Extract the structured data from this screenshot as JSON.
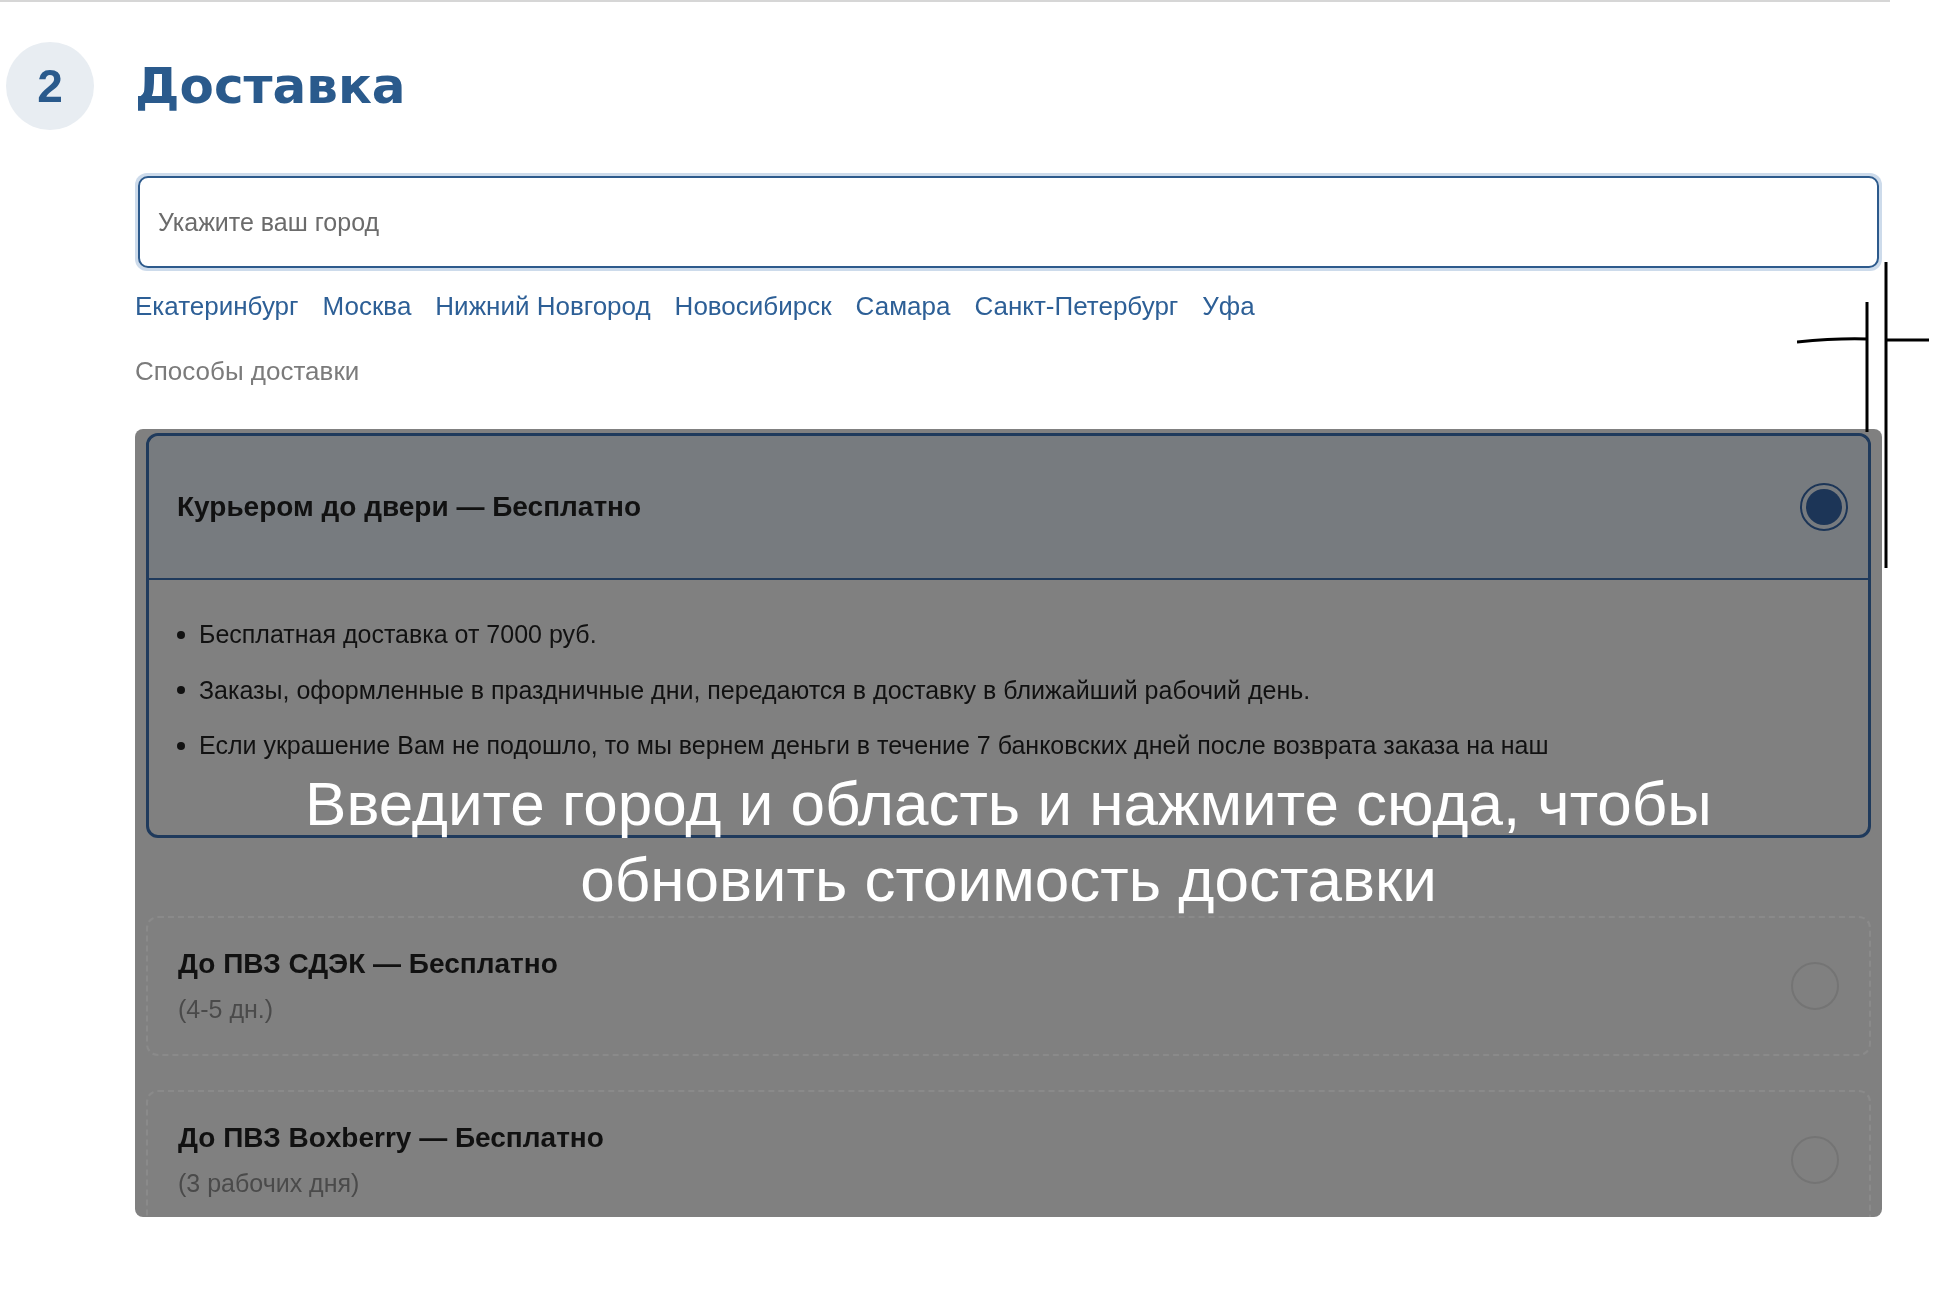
{
  "step": {
    "number": "2",
    "title": "Доставка"
  },
  "city_field": {
    "placeholder": "Укажите ваш город"
  },
  "cities": [
    "Екатеринбург",
    "Москва",
    "Нижний Новгород",
    "Новосибирск",
    "Самара",
    "Санкт-Петербург",
    "Уфа"
  ],
  "methods_label": "Способы доставки",
  "methods": [
    {
      "title": "Курьером до двери — Бесплатно",
      "selected": true,
      "details": [
        "Бесплатная доставка от 7000 руб.",
        "Заказы, оформленные в праздничные дни, передаются в доставку в ближайший рабочий день.",
        "Если украшение Вам не подошло, то мы вернем деньги в течение 7 банковских дней после возврата заказа на наш"
      ]
    },
    {
      "title": "До ПВЗ СДЭК — Бесплатно",
      "note": "(4-5 дн.)",
      "selected": false
    },
    {
      "title": "До ПВЗ Boxberry — Бесплатно",
      "note": "(3 рабочих дня)",
      "selected": false
    }
  ],
  "overlay_message": "Введите город и область и нажмите сюда, чтобы обновить стоимость доставки"
}
